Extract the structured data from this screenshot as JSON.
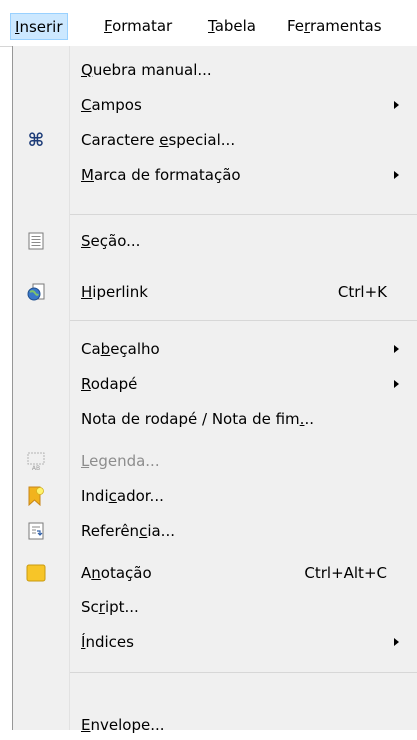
{
  "menubar": {
    "items": [
      {
        "pre": "",
        "key": "I",
        "post": "nserir"
      },
      {
        "pre": "",
        "key": "F",
        "post": "ormatar"
      },
      {
        "pre": "",
        "key": "T",
        "post": "abela"
      },
      {
        "pre": "Fe",
        "key": "r",
        "post": "ramentas"
      }
    ]
  },
  "menu": {
    "items": [
      {
        "pre": "",
        "key": "Q",
        "post": "uebra manual...",
        "shortcut": ""
      },
      {
        "pre": "",
        "key": "C",
        "post": "ampos",
        "shortcut": ""
      },
      {
        "pre": "Caractere ",
        "key": "e",
        "post": "special...",
        "shortcut": "",
        "icon": "command-icon"
      },
      {
        "pre": "",
        "key": "M",
        "post": "arca de formatação",
        "shortcut": ""
      },
      {
        "pre": "",
        "key": "S",
        "post": "eção...",
        "shortcut": "",
        "icon": "section-icon"
      },
      {
        "pre": "",
        "key": "H",
        "post": "iperlink",
        "shortcut": "Ctrl+K",
        "icon": "hyperlink-globe-icon"
      },
      {
        "pre": "Ca",
        "key": "b",
        "post": "eçalho",
        "shortcut": ""
      },
      {
        "pre": "",
        "key": "R",
        "post": "odapé",
        "shortcut": ""
      },
      {
        "pre": "Nota de rodapé / Nota de fim",
        "key": ".",
        "post": "..",
        "shortcut": ""
      },
      {
        "pre": "",
        "key": "L",
        "post": "egenda...",
        "shortcut": "",
        "icon": "caption-icon"
      },
      {
        "pre": "Indi",
        "key": "c",
        "post": "ador...",
        "shortcut": "",
        "icon": "bookmark-icon"
      },
      {
        "pre": "Referên",
        "key": "c",
        "post": "ia...",
        "shortcut": "",
        "icon": "cross-reference-icon"
      },
      {
        "pre": "A",
        "key": "n",
        "post": "otação",
        "shortcut": "Ctrl+Alt+C",
        "icon": "comment-icon"
      },
      {
        "pre": "Sc",
        "key": "r",
        "post": "ipt...",
        "shortcut": ""
      },
      {
        "pre": "",
        "key": "Í",
        "post": "ndices",
        "shortcut": ""
      },
      {
        "pre": "",
        "key": "E",
        "post": "nvelope...",
        "shortcut": ""
      }
    ]
  },
  "colors": {
    "menu_bg": "#f0f0f0",
    "active_bg": "#cce8ff",
    "active_border": "#99d1ff",
    "disabled_text": "#8d8d8d"
  }
}
